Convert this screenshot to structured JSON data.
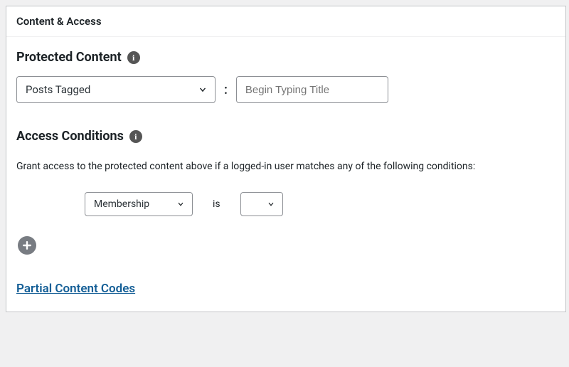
{
  "panel": {
    "title": "Content & Access"
  },
  "protected": {
    "heading": "Protected Content",
    "rule_type": "Posts Tagged",
    "title_placeholder": "Begin Typing Title"
  },
  "access": {
    "heading": "Access Conditions",
    "description": "Grant access to the protected content above if a logged-in user matches any of the following conditions:",
    "condition_type": "Membership",
    "operator": "is",
    "value": ""
  },
  "links": {
    "partial_codes": "Partial Content Codes"
  }
}
